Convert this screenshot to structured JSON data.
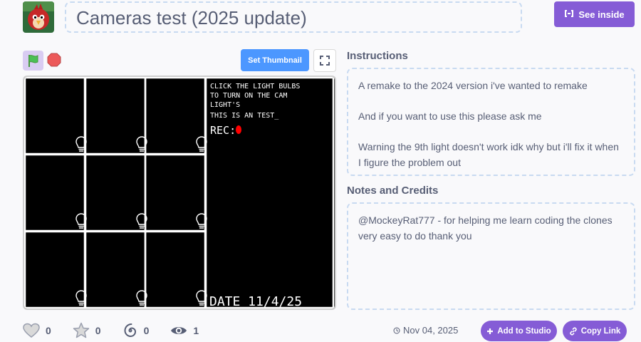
{
  "header": {
    "title": "Cameras test (2025 update)",
    "see_inside_label": "See inside"
  },
  "controls": {
    "set_thumbnail_label": "Set Thumbnail"
  },
  "stage": {
    "lines": [
      "CLICK THE LIGHT BULBS",
      "TO TURN ON THE CAM",
      "LIGHT'S",
      "THIS IS AN TEST_"
    ],
    "rec_label": "REC:",
    "date_label": "DATE 11/4/25",
    "camera_count": 9
  },
  "instructions": {
    "heading": "Instructions",
    "paragraphs": [
      "A remake to the 2024 version i've wanted to remake",
      "And if you want to use this please ask me",
      "Warning the 9th light doesn't work idk why but i'll fix it when I figure the problem out"
    ]
  },
  "notes": {
    "heading": "Notes and Credits",
    "text": "@MockeyRat777 - for helping me learn coding the clones very easy to do thank you"
  },
  "stats": {
    "loves": "0",
    "favorites": "0",
    "remixes": "0",
    "views": "1"
  },
  "meta": {
    "date": "Nov 04, 2025",
    "add_to_studio_label": "Add to Studio",
    "copy_link_label": "Copy Link"
  },
  "colors": {
    "accent": "#855cd6",
    "blue": "#4c97ff",
    "stage_bg": "#000000",
    "rec_dot": "#ff0000"
  },
  "icons": [
    "project-thumbnail",
    "remix-icon",
    "green-flag-icon",
    "stop-icon",
    "fullscreen-icon",
    "lightbulb-icon",
    "heart-icon",
    "star-icon",
    "remix-spiral-icon",
    "eye-icon",
    "remix-small-icon",
    "plus-icon",
    "link-icon"
  ]
}
